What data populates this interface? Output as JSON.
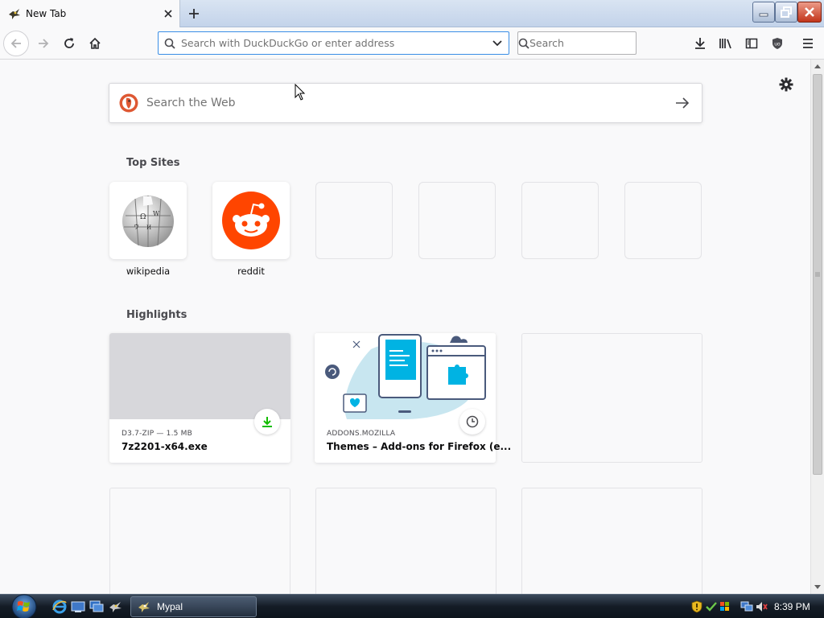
{
  "browser": {
    "tab": {
      "title": "New Tab",
      "favicon": "mypal-icon"
    },
    "toolbar": {
      "url_placeholder": "Search with DuckDuckGo or enter address",
      "search_placeholder": "Search"
    }
  },
  "newtab": {
    "websearch_placeholder": "Search the Web",
    "top_sites_title": "Top Sites",
    "top_sites": [
      {
        "label": "wikipedia",
        "icon": "wikipedia-globe-icon"
      },
      {
        "label": "reddit",
        "icon": "reddit-alien-icon"
      },
      {
        "label": ""
      },
      {
        "label": ""
      },
      {
        "label": ""
      },
      {
        "label": ""
      }
    ],
    "highlights_title": "Highlights",
    "highlights": [
      {
        "context": "D3.7-ZIP — 1.5 MB",
        "title": "7z2201-x64.exe",
        "badge": "download-icon"
      },
      {
        "context": "ADDONS.MOZILLA",
        "title": "Themes – Add-ons for Firefox (e...",
        "badge": "clock-icon"
      }
    ]
  },
  "taskbar": {
    "app_label": "Mypal",
    "clock": "8:39 PM"
  },
  "colors": {
    "accent_blue": "#3a8ee6",
    "download_green": "#12bc00",
    "reddit_orange": "#ff4500",
    "ddg_orange": "#de5833"
  }
}
